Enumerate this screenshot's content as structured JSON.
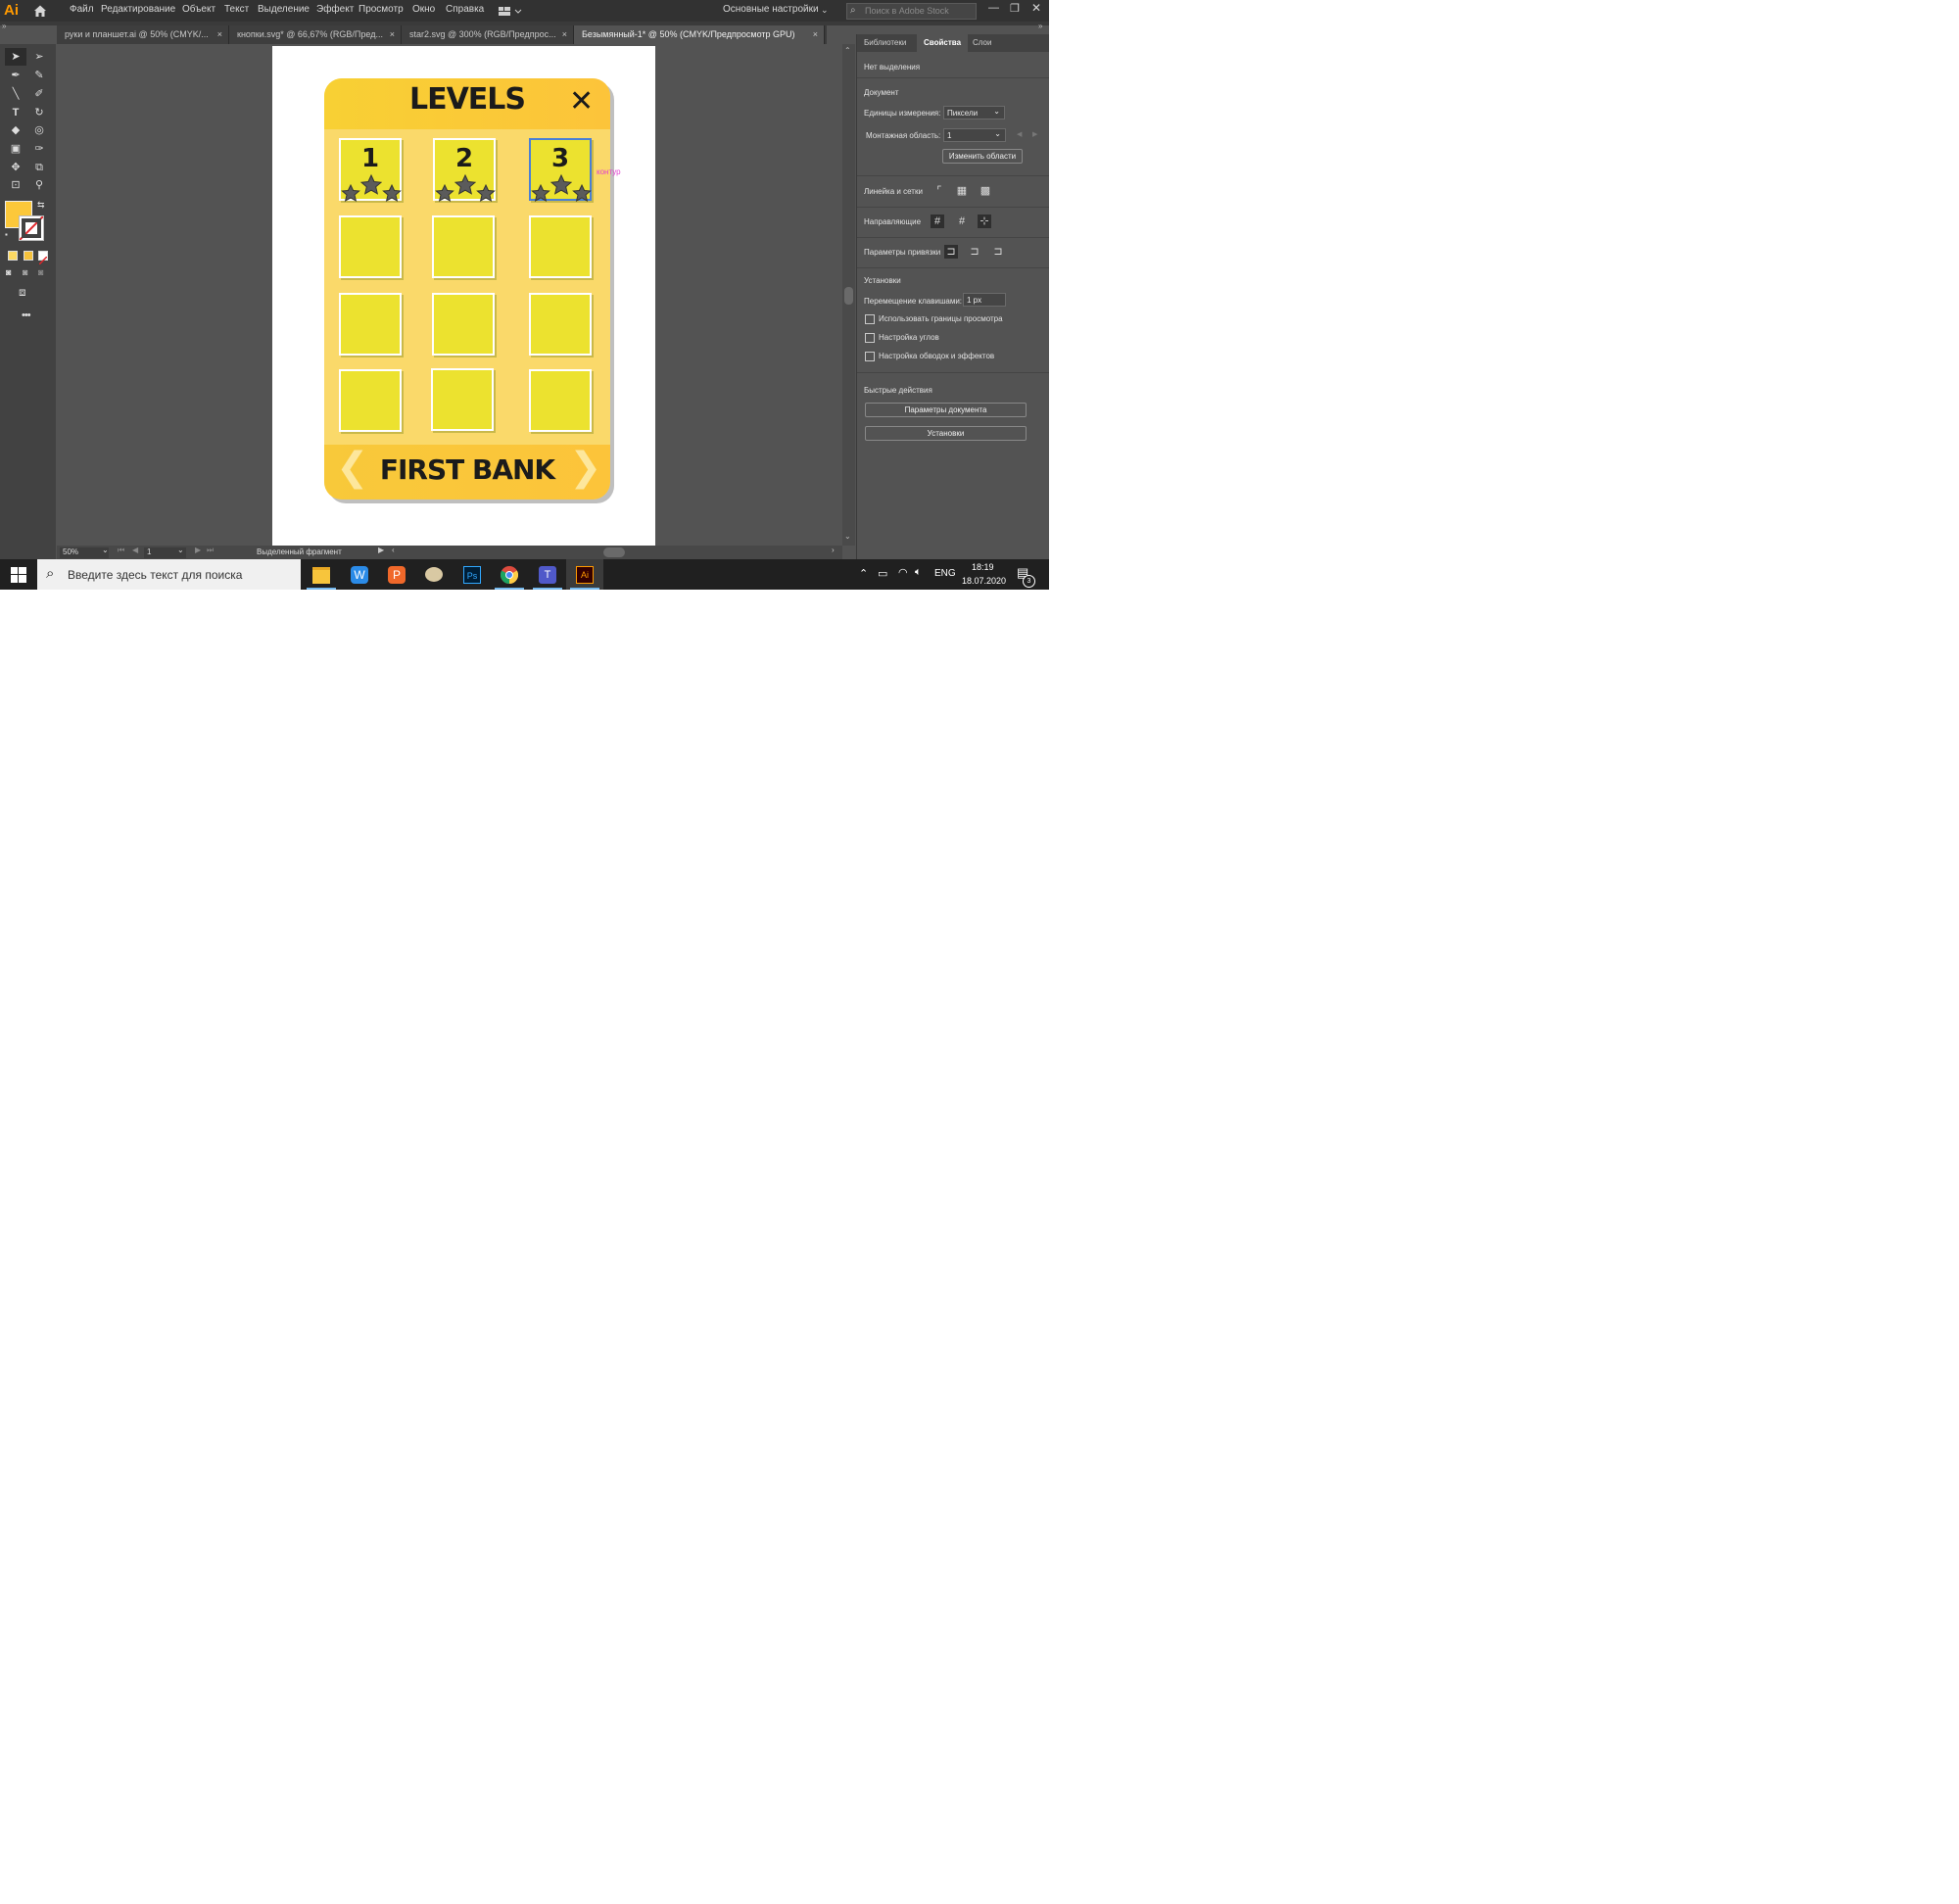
{
  "app": {
    "logo": "Ai",
    "menu": [
      "Файл",
      "Редактирование",
      "Объект",
      "Текст",
      "Выделение",
      "Эффект",
      "Просмотр",
      "Окно",
      "Справка"
    ],
    "workspace": "Основные настройки",
    "stock_search_placeholder": "Поиск в Adobe Stock"
  },
  "tabs": [
    {
      "label": "руки и планшет.ai @ 50% (CMYK/...",
      "close": "×"
    },
    {
      "label": "кнопки.svg* @ 66,67% (RGB/Пред...",
      "close": "×"
    },
    {
      "label": "star2.svg @ 300% (RGB/Предпрос...",
      "close": "×"
    },
    {
      "label": "Безымянный-1* @ 50% (CMYK/Предпросмотр GPU)",
      "close": "×",
      "active": true
    }
  ],
  "artwork": {
    "title": "LEVELS",
    "close_symbol": "✕",
    "levels": [
      "1",
      "2",
      "3"
    ],
    "footer": "FIRST BANK",
    "left_arrow": "❮",
    "right_arrow": "❯",
    "hint_label": "контур",
    "colors": {
      "card": "#fad96a",
      "header": "#fbc93a",
      "tile": "#ece22f",
      "star": "#5b5b5b"
    }
  },
  "status": {
    "zoom": "50%",
    "artboard_num": "1",
    "selection_label": "Выделенный фрагмент"
  },
  "panel": {
    "tabs": [
      "Библиотеки",
      "Свойства",
      "Слои"
    ],
    "no_selection": "Нет выделения",
    "document_heading": "Документ",
    "units_label": "Единицы измерения:",
    "units_value": "Пиксели",
    "artboard_label": "Монтажная область:",
    "artboard_value": "1",
    "edit_artboards": "Изменить области",
    "rulers_grids": "Линейка и сетки",
    "guides": "Направляющие",
    "snap_options": "Параметры привязки",
    "preferences_heading": "Установки",
    "keyboard_increment_label": "Перемещение клавишами:",
    "keyboard_increment_value": "1 px",
    "check_preview_bounds": "Использовать границы просмотра",
    "check_corners": "Настройка углов",
    "check_strokes": "Настройка обводок и эффектов",
    "quick_actions": "Быстрые действия",
    "doc_setup": "Параметры документа",
    "preferences_button": "Установки"
  },
  "taskbar": {
    "search_placeholder": "Введите здесь текст для поиска",
    "lang": "ENG",
    "time": "18:19",
    "date": "18.07.2020",
    "notifications": "3"
  }
}
